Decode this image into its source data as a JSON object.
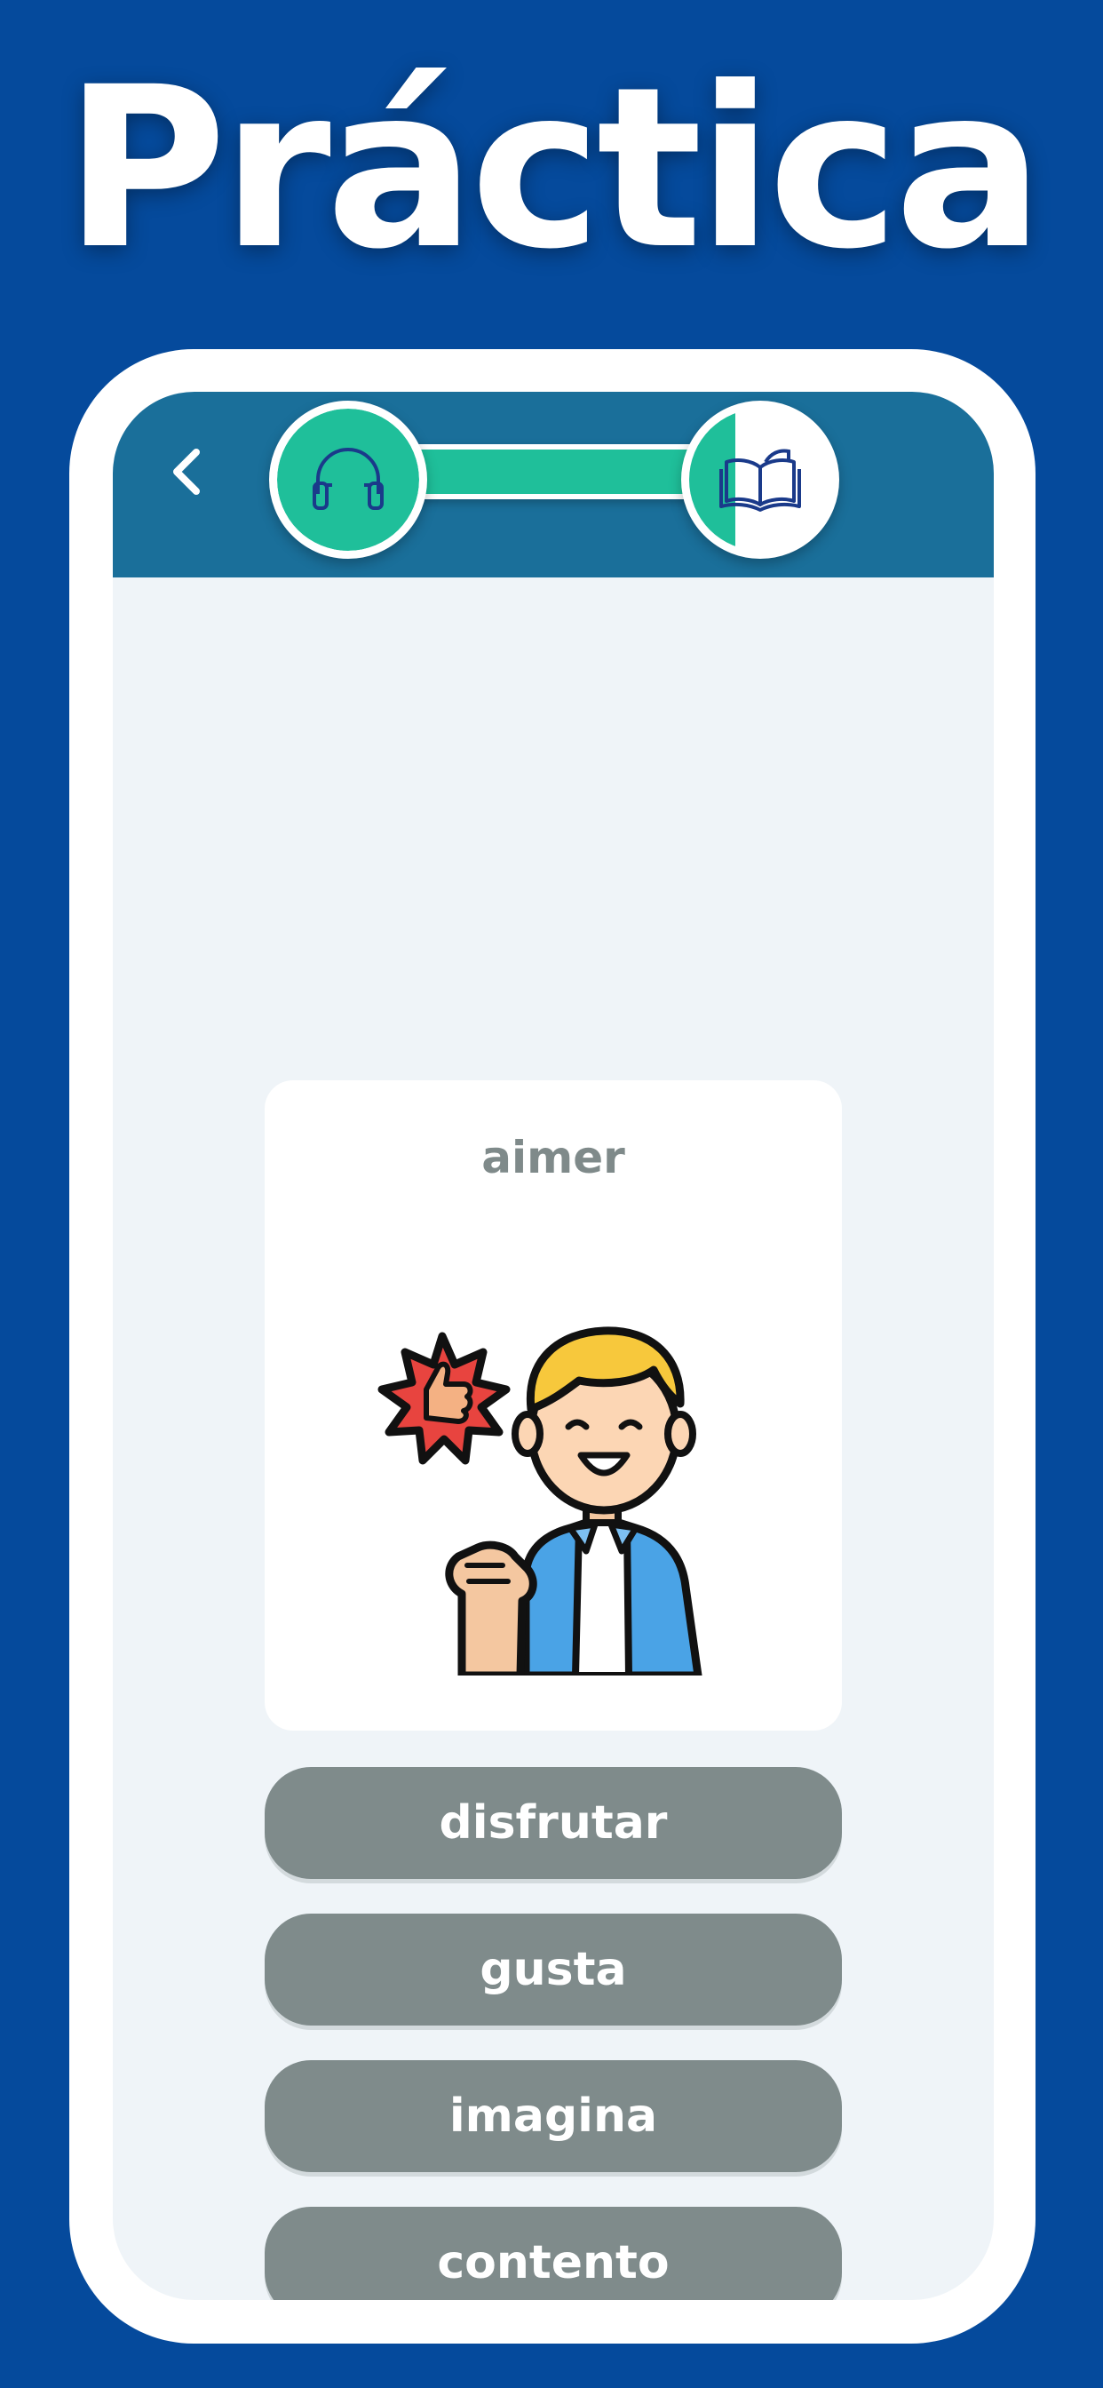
{
  "headline": "Práctica",
  "header": {
    "back_icon": "chevron-left-icon",
    "start_icon": "headphones-icon",
    "end_icon": "open-book-icon"
  },
  "card": {
    "word": "aimer",
    "illustration": "person-thumbs-up-illustration"
  },
  "options": [
    "disfrutar",
    "gusta",
    "imagina",
    "contento"
  ],
  "colors": {
    "background": "#054a9c",
    "appbar": "#1a6f9a",
    "progress": "#1fbf9a",
    "option_button": "#7f8b8b",
    "screen": "#eff4f8"
  }
}
